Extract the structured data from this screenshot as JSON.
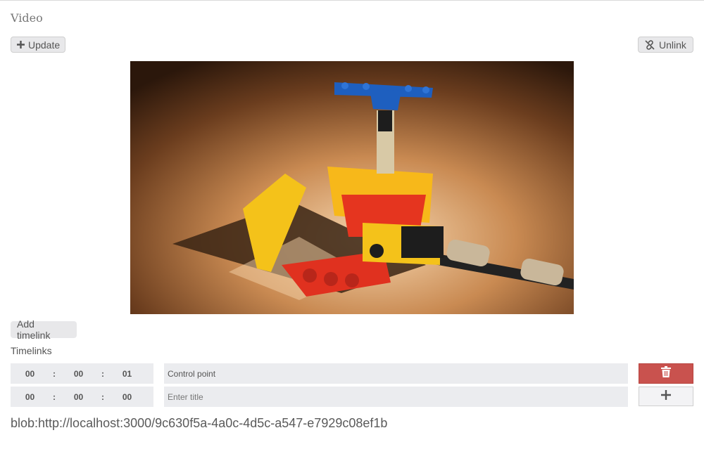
{
  "section": {
    "title": "Video"
  },
  "toolbar": {
    "update_label": "Update",
    "unlink_label": "Unlink",
    "update_icon": "plus-icon",
    "unlink_icon": "unlink-icon"
  },
  "video": {
    "description_icon": "video-player"
  },
  "timelinks": {
    "add_label": "Add timelink",
    "heading": "Timelinks",
    "rows": [
      {
        "hours": "00",
        "minutes": "00",
        "seconds": "01",
        "title": "Control point",
        "placeholder": "Enter title"
      },
      {
        "hours": "00",
        "minutes": "00",
        "seconds": "00",
        "title": "",
        "placeholder": "Enter title"
      }
    ],
    "separator": ":"
  },
  "source": {
    "url": "blob:http://localhost:3000/9c630f5a-4a0c-4d5c-a547-e7929c08ef1b"
  },
  "colors": {
    "danger": "#c9524e",
    "field": "#ebecef"
  }
}
